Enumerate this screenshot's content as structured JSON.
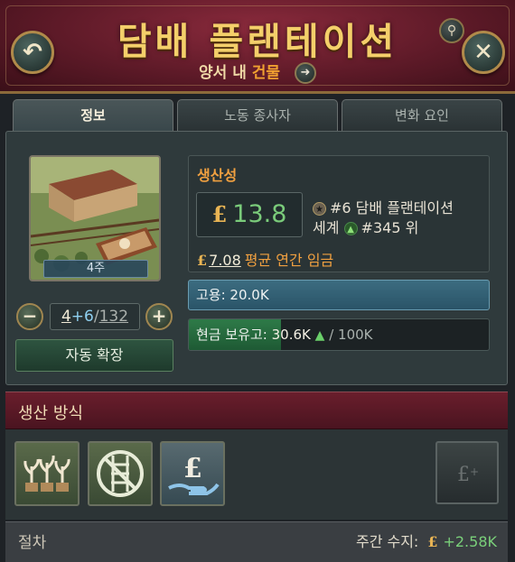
{
  "header": {
    "title": "담배 플랜테이션",
    "subtitle_region": "양서",
    "subtitle_mid": "내",
    "subtitle_link": "건물"
  },
  "tabs": [
    {
      "label": "정보",
      "active": true
    },
    {
      "label": "노동 종사자",
      "active": false
    },
    {
      "label": "변화 요인",
      "active": false
    }
  ],
  "building": {
    "count_label": "4주",
    "level_current": "4",
    "level_add": "+6",
    "level_sep": "/",
    "level_max": "132",
    "auto_expand_label": "자동 확장"
  },
  "productivity": {
    "title": "생산성",
    "currency_symbol": "£",
    "value": "13.8",
    "rank_text": "#6 담배 플랜테이션",
    "world_label": "세계",
    "world_rank": "#345 위",
    "wage_value": "7.08",
    "wage_label": "평균 연간 임금"
  },
  "employment": {
    "text": "고용: 20.0K"
  },
  "cash": {
    "label": "현금 보유고:",
    "value": "30.6K",
    "cap": "/ 100K",
    "fill_fraction": 0.306
  },
  "production_methods": {
    "title": "생산 방식"
  },
  "footer": {
    "left_label": "절차",
    "weekly_label": "주간 수지:",
    "currency_symbol": "£",
    "weekly_value": "+2.58K"
  },
  "colors": {
    "header_bg": "#5e1a28",
    "title_gold": "#f4cf6a",
    "accent_orange": "#f0a040",
    "positive_green": "#7acb7a",
    "employment_blue": "#3c6c80",
    "cash_green": "#2e7a48"
  },
  "icons": {
    "back": "back-arrow-icon",
    "close": "close-icon",
    "search": "search-icon",
    "subtitle_go": "right-arrow-icon"
  }
}
